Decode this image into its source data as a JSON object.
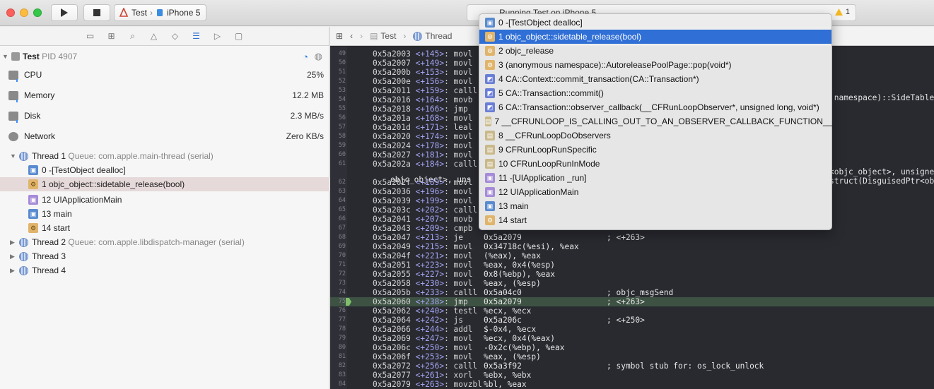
{
  "toolbar": {
    "scheme_target": "Test",
    "scheme_device": "iPhone 5",
    "status_text": "Running Test on iPhone 5",
    "warning_count": "1"
  },
  "navigator": {
    "process": {
      "name": "Test",
      "pid": "PID 4907"
    },
    "gauges": [
      {
        "label": "CPU",
        "value": "25%"
      },
      {
        "label": "Memory",
        "value": "12.2 MB"
      },
      {
        "label": "Disk",
        "value": "2.3 MB/s"
      },
      {
        "label": "Network",
        "value": "Zero KB/s"
      }
    ],
    "thread1": {
      "name": "Thread 1",
      "queue": "Queue: com.apple.main-thread (serial)"
    },
    "frames": [
      {
        "label": "0 -[TestObject dealloc]",
        "kind": "user"
      },
      {
        "label": "1 objc_object::sidetable_release(bool)",
        "kind": "lib"
      },
      {
        "label": "12 UIApplicationMain",
        "kind": "ui"
      },
      {
        "label": "13 main",
        "kind": "user"
      },
      {
        "label": "14 start",
        "kind": "lib"
      }
    ],
    "thread2": {
      "name": "Thread 2",
      "queue": "Queue: com.apple.libdispatch-manager (serial)"
    },
    "thread3": {
      "name": "Thread 3"
    },
    "thread4": {
      "name": "Thread 4"
    }
  },
  "editor": {
    "breadcrumb_project": "Test",
    "breadcrumb_thread": "Thread",
    "overflow_line": "objc_object>, uns",
    "overflow_right_a": " namespace)::SideTable",
    "overflow_right_b": "<objc_object>, unsigne",
    "overflow_right_c": "struct(DisguisedPtr<ob",
    "lines": [
      {
        "ln": "49",
        "addr": "0x5a2003",
        "off": "<+145>",
        "op": "movl",
        "arg": "",
        "cmt": ""
      },
      {
        "ln": "50",
        "addr": "0x5a2007",
        "off": "<+149>",
        "op": "movl",
        "arg": "",
        "cmt": ""
      },
      {
        "ln": "51",
        "addr": "0x5a200b",
        "off": "<+153>",
        "op": "movl",
        "arg": "",
        "cmt": ""
      },
      {
        "ln": "52",
        "addr": "0x5a200e",
        "off": "<+156>",
        "op": "movl",
        "arg": "",
        "cmt": ""
      },
      {
        "ln": "53",
        "addr": "0x5a2011",
        "off": "<+159>",
        "op": "calll",
        "arg": "",
        "cmt": ""
      },
      {
        "ln": "54",
        "addr": "0x5a2016",
        "off": "<+164>",
        "op": "movb",
        "arg": "",
        "cmt": ""
      },
      {
        "ln": "55",
        "addr": "0x5a2018",
        "off": "<+166>",
        "op": "jmp",
        "arg": "",
        "cmt": ""
      },
      {
        "ln": "56",
        "addr": "0x5a201a",
        "off": "<+168>",
        "op": "movl",
        "arg": "",
        "cmt": ""
      },
      {
        "ln": "57",
        "addr": "0x5a201d",
        "off": "<+171>",
        "op": "leal",
        "arg": "",
        "cmt": ""
      },
      {
        "ln": "58",
        "addr": "0x5a2020",
        "off": "<+174>",
        "op": "movl",
        "arg": "",
        "cmt": ""
      },
      {
        "ln": "59",
        "addr": "0x5a2024",
        "off": "<+178>",
        "op": "movl",
        "arg": "",
        "cmt": ""
      },
      {
        "ln": "60",
        "addr": "0x5a2027",
        "off": "<+181>",
        "op": "movl",
        "arg": "",
        "cmt": ""
      },
      {
        "ln": "61",
        "addr": "0x5a202a",
        "off": "<+184>",
        "op": "calll",
        "arg": "",
        "cmt": ""
      },
      {
        "ln": "62",
        "addr": "0x5a202f",
        "off": "<+189>",
        "op": "movl",
        "arg": "",
        "cmt": ""
      },
      {
        "ln": "63",
        "addr": "0x5a2036",
        "off": "<+196>",
        "op": "movl",
        "arg": "",
        "cmt": ""
      },
      {
        "ln": "64",
        "addr": "0x5a2039",
        "off": "<+199>",
        "op": "movl",
        "arg": "",
        "cmt": ""
      },
      {
        "ln": "65",
        "addr": "0x5a203c",
        "off": "<+202>",
        "op": "calll",
        "arg": "",
        "cmt": ""
      },
      {
        "ln": "66",
        "addr": "0x5a2041",
        "off": "<+207>",
        "op": "movb",
        "arg": "",
        "cmt": ""
      },
      {
        "ln": "67",
        "addr": "0x5a2043",
        "off": "<+209>",
        "op": "cmpb",
        "arg": "",
        "cmt": ""
      },
      {
        "ln": "68",
        "addr": "0x5a2047",
        "off": "<+213>",
        "op": "je",
        "arg": "0x5a2079",
        "cmt": "; <+263>"
      },
      {
        "ln": "69",
        "addr": "0x5a2049",
        "off": "<+215>",
        "op": "movl",
        "arg": "0x34718c(%esi), %eax",
        "cmt": ""
      },
      {
        "ln": "70",
        "addr": "0x5a204f",
        "off": "<+221>",
        "op": "movl",
        "arg": "(%eax), %eax",
        "cmt": ""
      },
      {
        "ln": "71",
        "addr": "0x5a2051",
        "off": "<+223>",
        "op": "movl",
        "arg": "%eax, 0x4(%esp)",
        "cmt": ""
      },
      {
        "ln": "72",
        "addr": "0x5a2055",
        "off": "<+227>",
        "op": "movl",
        "arg": "0x8(%ebp), %eax",
        "cmt": ""
      },
      {
        "ln": "73",
        "addr": "0x5a2058",
        "off": "<+230>",
        "op": "movl",
        "arg": "%eax, (%esp)",
        "cmt": ""
      },
      {
        "ln": "74",
        "addr": "0x5a205b",
        "off": "<+233>",
        "op": "calll",
        "arg": "0x5a04c0",
        "cmt": "; objc_msgSend"
      },
      {
        "ln": "75",
        "addr": "0x5a2060",
        "off": "<+238>",
        "op": "jmp",
        "arg": "0x5a2079",
        "cmt": "; <+263>"
      },
      {
        "ln": "76",
        "addr": "0x5a2062",
        "off": "<+240>",
        "op": "testl",
        "arg": "%ecx, %ecx",
        "cmt": ""
      },
      {
        "ln": "77",
        "addr": "0x5a2064",
        "off": "<+242>",
        "op": "js",
        "arg": "0x5a206c",
        "cmt": "; <+250>"
      },
      {
        "ln": "78",
        "addr": "0x5a2066",
        "off": "<+244>",
        "op": "addl",
        "arg": "$-0x4, %ecx",
        "cmt": ""
      },
      {
        "ln": "79",
        "addr": "0x5a2069",
        "off": "<+247>",
        "op": "movl",
        "arg": "%ecx, 0x4(%eax)",
        "cmt": ""
      },
      {
        "ln": "80",
        "addr": "0x5a206c",
        "off": "<+250>",
        "op": "movl",
        "arg": "-0x2c(%ebp), %eax",
        "cmt": ""
      },
      {
        "ln": "81",
        "addr": "0x5a206f",
        "off": "<+253>",
        "op": "movl",
        "arg": "%eax, (%esp)",
        "cmt": ""
      },
      {
        "ln": "82",
        "addr": "0x5a2072",
        "off": "<+256>",
        "op": "calll",
        "arg": "0x5a3f92",
        "cmt": "; symbol stub for: os_lock_unlock"
      },
      {
        "ln": "83",
        "addr": "0x5a2077",
        "off": "<+261>",
        "op": "xorl",
        "arg": "%ebx, %ebx",
        "cmt": ""
      },
      {
        "ln": "84",
        "addr": "0x5a2079",
        "off": "<+263>",
        "op": "movzbl",
        "arg": "%bl, %eax",
        "cmt": ""
      }
    ]
  },
  "popup": {
    "items": [
      {
        "label": "0 -[TestObject dealloc]",
        "kind": "user"
      },
      {
        "label": "1 objc_object::sidetable_release(bool)",
        "kind": "lib"
      },
      {
        "label": "2 objc_release",
        "kind": "lib"
      },
      {
        "label": "3 (anonymous namespace)::AutoreleasePoolPage::pop(void*)",
        "kind": "lib"
      },
      {
        "label": "4 CA::Context::commit_transaction(CA::Transaction*)",
        "kind": "ca"
      },
      {
        "label": "5 CA::Transaction::commit()",
        "kind": "ca"
      },
      {
        "label": "6 CA::Transaction::observer_callback(__CFRunLoopObserver*, unsigned long, void*)",
        "kind": "ca"
      },
      {
        "label": "7 __CFRUNLOOP_IS_CALLING_OUT_TO_AN_OBSERVER_CALLBACK_FUNCTION__",
        "kind": "cf"
      },
      {
        "label": "8 __CFRunLoopDoObservers",
        "kind": "cf"
      },
      {
        "label": "9 CFRunLoopRunSpecific",
        "kind": "cf"
      },
      {
        "label": "10 CFRunLoopRunInMode",
        "kind": "cf"
      },
      {
        "label": "11 -[UIApplication _run]",
        "kind": "ui"
      },
      {
        "label": "12 UIApplicationMain",
        "kind": "ui"
      },
      {
        "label": "13 main",
        "kind": "user"
      },
      {
        "label": "14 start",
        "kind": "lib"
      }
    ]
  }
}
